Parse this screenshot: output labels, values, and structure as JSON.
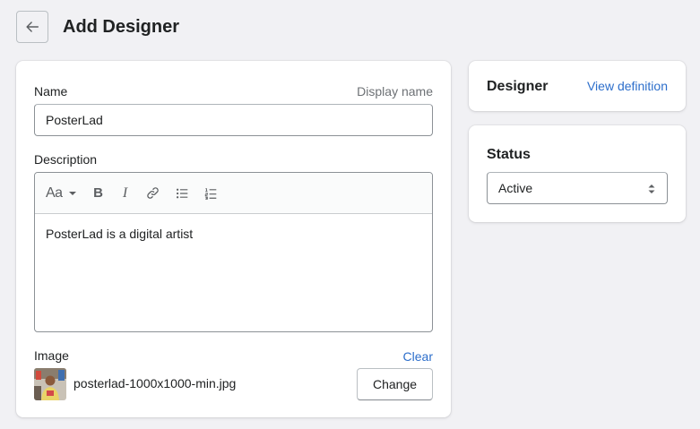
{
  "page": {
    "title": "Add Designer"
  },
  "main_card": {
    "name_label": "Name",
    "name_hint": "Display name",
    "name_value": "PosterLad",
    "description_label": "Description",
    "description_value": "PosterLad is a digital artist",
    "toolbar": {
      "text_style_label": "Aa",
      "bold_label": "B",
      "italic_label": "I"
    },
    "image_label": "Image",
    "clear_label": "Clear",
    "file_name": "posterlad-1000x1000-min.jpg",
    "change_label": "Change"
  },
  "designer_card": {
    "heading": "Designer",
    "view_definition_label": "View definition"
  },
  "status_card": {
    "heading": "Status",
    "selected_value": "Active"
  },
  "colors": {
    "background": "#f1f1f4",
    "link": "#2c6ecb",
    "text": "#202223",
    "muted": "#6d7175"
  }
}
